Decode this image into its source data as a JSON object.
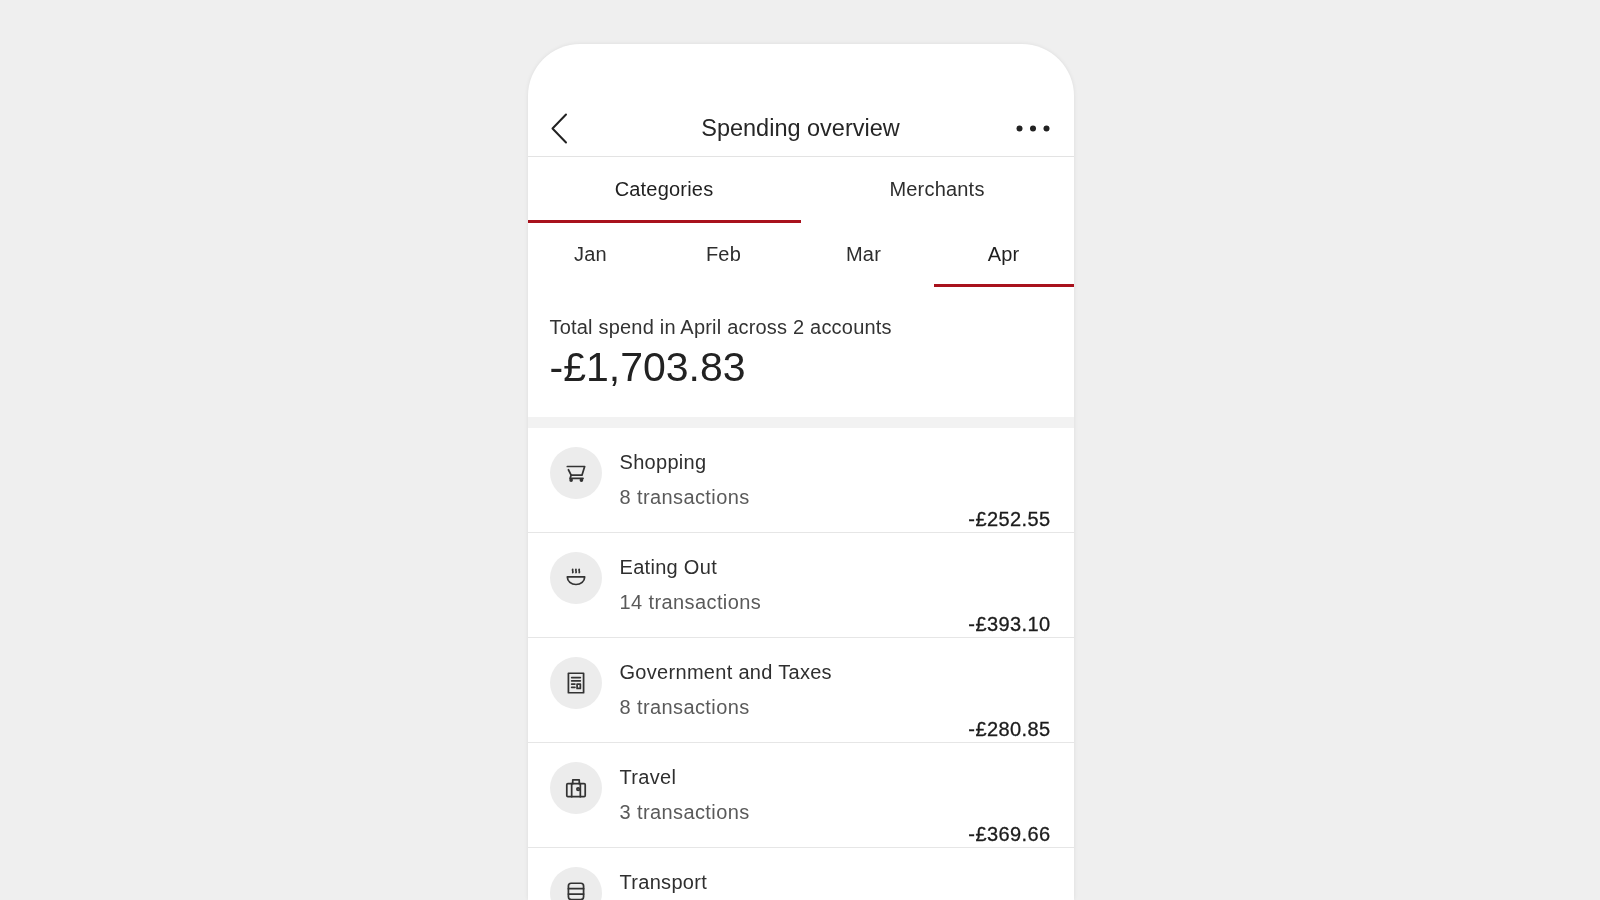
{
  "header": {
    "title": "Spending overview"
  },
  "view_tabs": [
    {
      "label": "Categories",
      "selected": true
    },
    {
      "label": "Merchants",
      "selected": false
    }
  ],
  "month_tabs": [
    {
      "label": "Jan",
      "selected": false
    },
    {
      "label": "Feb",
      "selected": false
    },
    {
      "label": "Mar",
      "selected": false
    },
    {
      "label": "Apr",
      "selected": true
    }
  ],
  "summary": {
    "caption": "Total spend in April across 2 accounts",
    "total": "-£1,703.83"
  },
  "categories": [
    {
      "kind": "shopping",
      "name": "Shopping",
      "count": "8 transactions",
      "amount": "-£252.55"
    },
    {
      "kind": "eating_out",
      "name": "Eating Out",
      "count": "14 transactions",
      "amount": "-£393.10"
    },
    {
      "kind": "government",
      "name": "Government and Taxes",
      "count": "8 transactions",
      "amount": "-£280.85"
    },
    {
      "kind": "travel",
      "name": "Travel",
      "count": "3 transactions",
      "amount": "-£369.66"
    },
    {
      "kind": "transport",
      "name": "Transport"
    }
  ]
}
